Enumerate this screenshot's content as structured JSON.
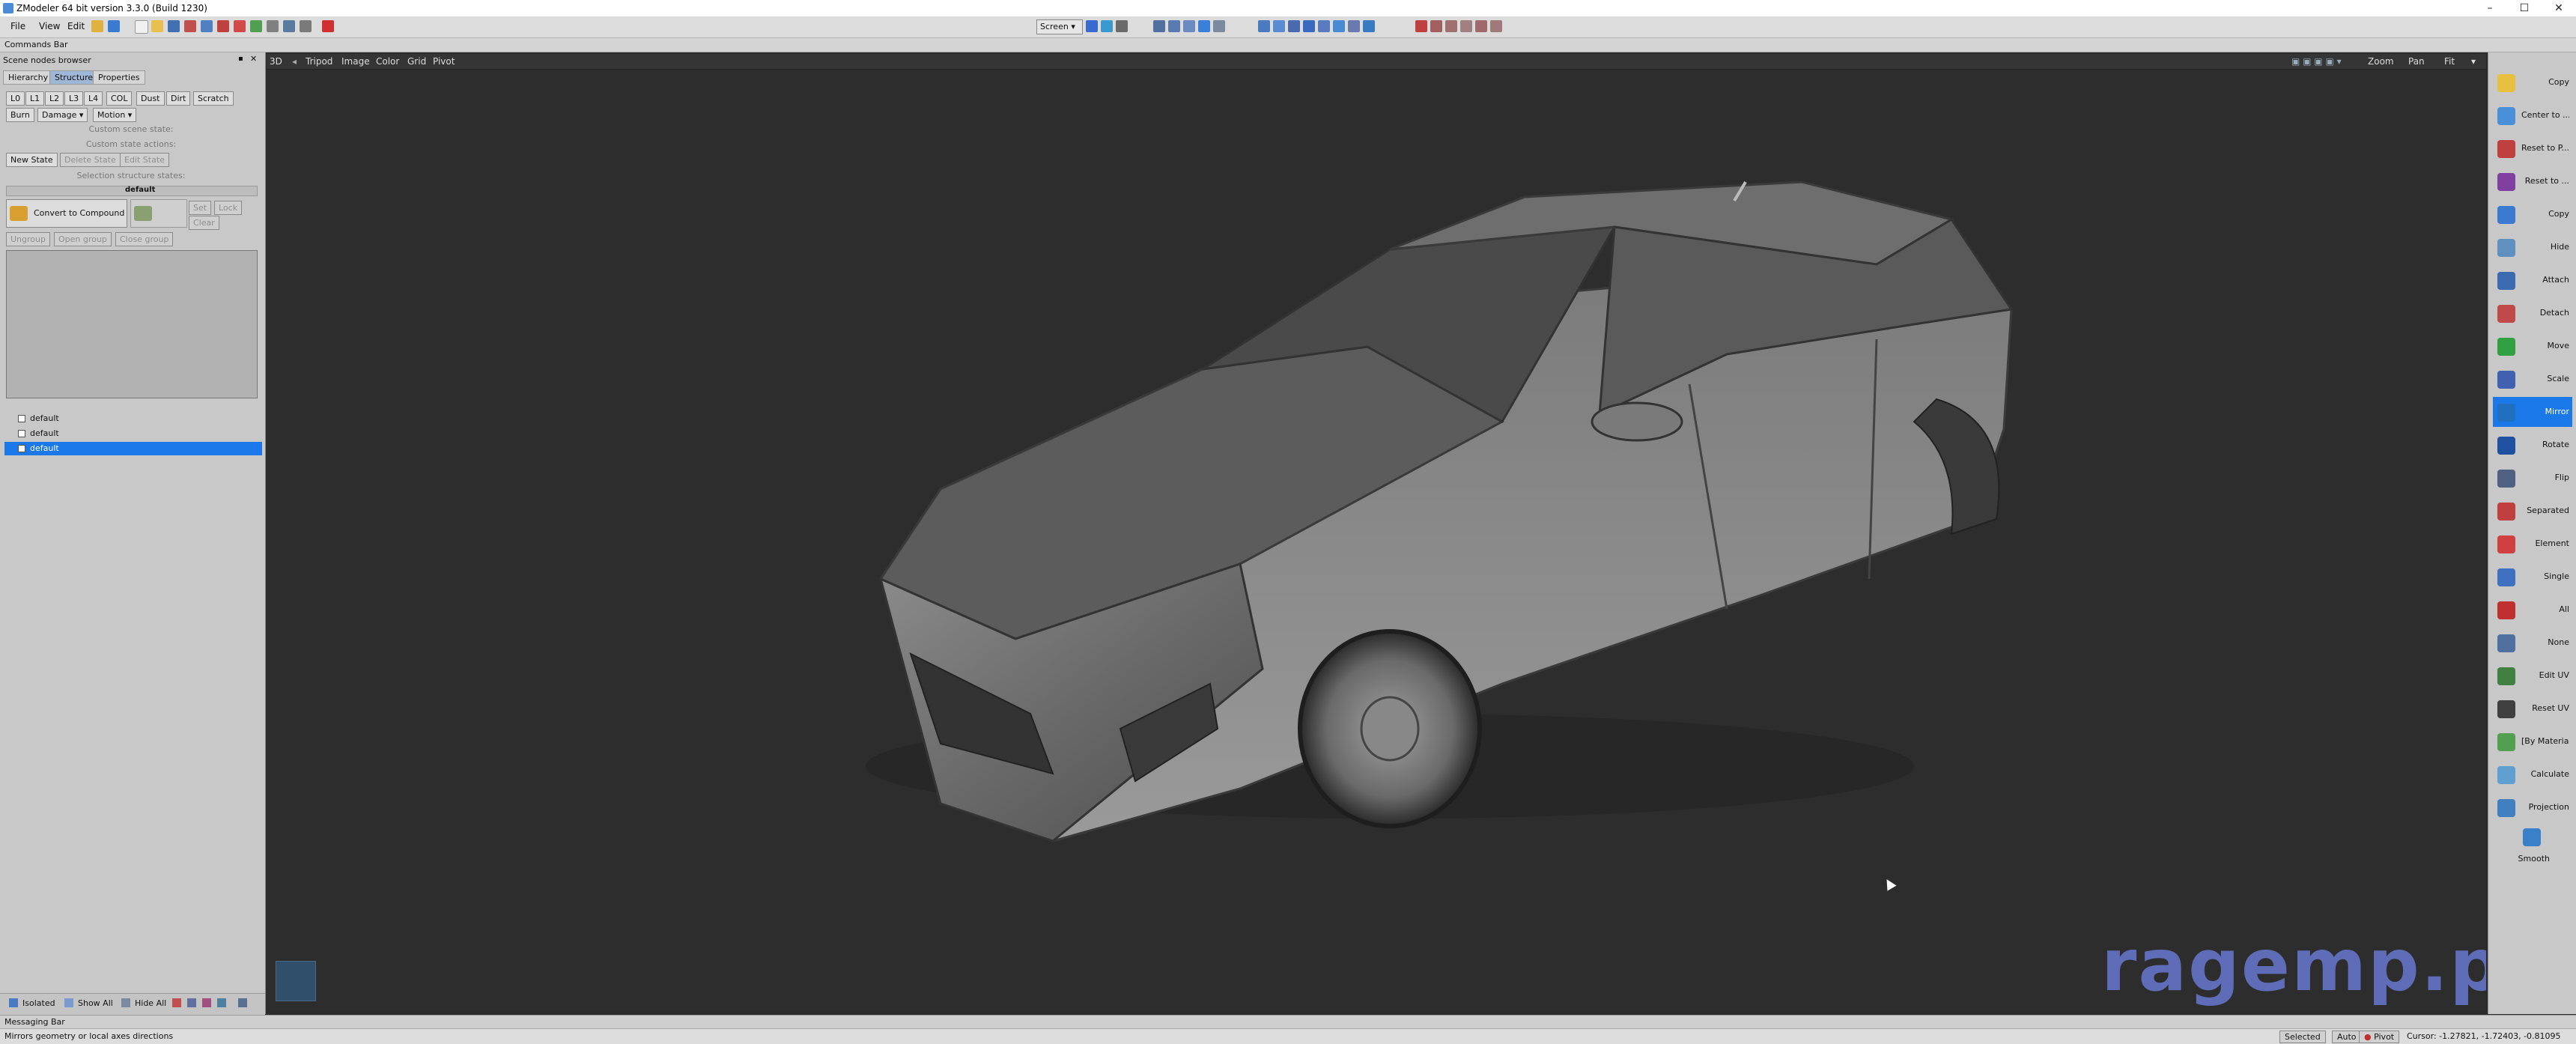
{
  "window": {
    "title": "ZModeler 64 bit version 3.3.0 (Build 1230)",
    "minimize": "–",
    "maximize": "☐",
    "close": "✕"
  },
  "menus": [
    "File",
    "View",
    "Edit"
  ],
  "toolbar": {
    "coord_mode": "Screen"
  },
  "commands_bar": "Commands Bar",
  "left_panel": {
    "title": "Scene nodes browser",
    "tabs": [
      "Hierarchy",
      "Structure",
      "Properties"
    ],
    "lod_buttons": [
      "L0",
      "L1",
      "L2",
      "L3",
      "L4",
      "COL",
      "Dust",
      "Dirt",
      "Scratch"
    ],
    "row2_buttons": [
      "Burn",
      "Damage",
      "Motion"
    ],
    "sep_custom_scene": "Custom scene state:",
    "sep_custom_actions": "Custom state actions:",
    "state_buttons": [
      "New State",
      "Delete State",
      "Edit State"
    ],
    "sep_selection": "Selection structure states:",
    "state_name": "default",
    "convert_label": "Convert to Compound",
    "small_buttons": [
      "Set",
      "Lock",
      "Clear"
    ],
    "group_buttons": [
      "Ungroup",
      "Open group",
      "Close group"
    ],
    "tree_items": [
      "default",
      "default",
      "default"
    ],
    "bottom": {
      "isolated": "Isolated",
      "show_all": "Show All",
      "hide_all": "Hide All"
    }
  },
  "viewport": {
    "menu": [
      "3D",
      "Tripod",
      "Image",
      "Color",
      "Grid",
      "Pivot"
    ],
    "right_menu": [
      "Zoom",
      "Pan",
      "Fit"
    ],
    "watermark": "ragemp.pro"
  },
  "right_panel": [
    {
      "label": "Copy",
      "color": "#e8c040"
    },
    {
      "label": "Center to ...",
      "color": "#4a90d8"
    },
    {
      "label": "Reset to P...",
      "color": "#c04040"
    },
    {
      "label": "Reset to ...",
      "color": "#8040a0"
    },
    {
      "label": "Copy",
      "color": "#3a7ad0"
    },
    {
      "label": "Hide",
      "color": "#6090c0"
    },
    {
      "label": "Attach",
      "color": "#3a6ab0"
    },
    {
      "label": "Detach",
      "color": "#c04a4a"
    },
    {
      "label": "Move",
      "color": "#30a040"
    },
    {
      "label": "Scale",
      "color": "#4060b0"
    },
    {
      "label": "Mirror",
      "color": "#2070c0"
    },
    {
      "label": "Rotate",
      "color": "#2050a0"
    },
    {
      "label": "Flip",
      "color": "#506080"
    },
    {
      "label": "Separated",
      "color": "#c04040"
    },
    {
      "label": "Element",
      "color": "#d04040"
    },
    {
      "label": "Single",
      "color": "#4070c0"
    },
    {
      "label": "All",
      "color": "#c03030"
    },
    {
      "label": "None",
      "color": "#5070a0"
    },
    {
      "label": "Edit UV",
      "color": "#408040"
    },
    {
      "label": "Reset UV",
      "color": "#404040"
    },
    {
      "label": "[By Material]",
      "color": "#50a050"
    },
    {
      "label": "Calculate",
      "color": "#60a0d0"
    },
    {
      "label": "Projection",
      "color": "#4080c0"
    },
    {
      "label": "Smooth",
      "color": "#3a80c8"
    }
  ],
  "messaging_bar": "Messaging Bar",
  "status": {
    "message": "Mirrors geometry or local axes directions",
    "selected": "Selected",
    "auto": "Auto",
    "pivot": "Pivot",
    "cursor": "Cursor: -1.27821, -1.72403, -0.81095"
  }
}
